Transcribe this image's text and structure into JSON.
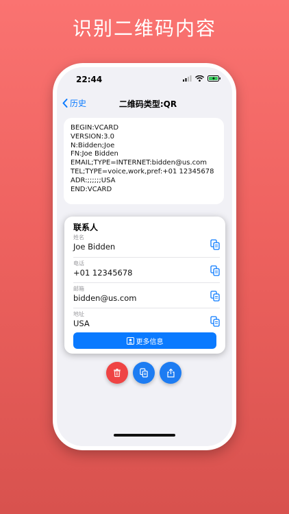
{
  "promo": {
    "headline": "识别二维码内容"
  },
  "status_bar": {
    "time": "22:44"
  },
  "nav": {
    "back_label": "历史",
    "title": "二维码类型:QR"
  },
  "raw_content": "BEGIN:VCARD\nVERSION:3.0\nN:Bidden;Joe\nFN:Joe Bidden\nEMAIL;TYPE=INTERNET:bidden@us.com\nTEL;TYPE=voice,work,pref:+01 12345678\nADR:;;;;;;USA\nEND:VCARD",
  "contact": {
    "title": "联系人",
    "fields": [
      {
        "label": "姓名",
        "value": "Joe Bidden"
      },
      {
        "label": "电话",
        "value": "+01 12345678"
      },
      {
        "label": "邮箱",
        "value": "bidden@us.com"
      },
      {
        "label": "地址",
        "value": "USA"
      }
    ],
    "more_button": "更多信息"
  },
  "colors": {
    "accent": "#0a7aff",
    "delete": "#ef4444",
    "background_top": "#fa7371",
    "background_bottom": "#d8524e"
  },
  "icons": {
    "back": "chevron-left-icon",
    "copy": "copy-icon",
    "contact": "contact-card-icon",
    "delete": "trash-icon",
    "share": "share-icon"
  }
}
